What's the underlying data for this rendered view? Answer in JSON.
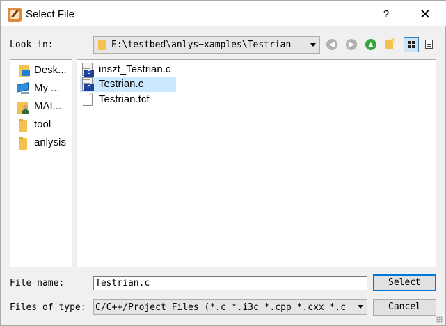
{
  "window": {
    "title": "Select File",
    "help_glyph": "?",
    "close_glyph": "✕"
  },
  "lookin": {
    "label": "Look in:",
    "path": "E:\\testbed\\anlys⋯xamples\\Testrian"
  },
  "toolbar": {
    "back_glyph": "◀",
    "forward_glyph": "▶",
    "up_glyph": "▲",
    "icons": [
      "back-icon",
      "forward-icon",
      "up-arrow-icon",
      "new-folder-icon",
      "detail-view-icon",
      "list-view-icon"
    ],
    "active_view": "detail"
  },
  "sidebar": {
    "items": [
      {
        "label": "Desk...",
        "icon": "desktop-icon"
      },
      {
        "label": "My ...",
        "icon": "computer-icon"
      },
      {
        "label": "MAI...",
        "icon": "user-folder-icon"
      },
      {
        "label": "tool",
        "icon": "folder-icon"
      },
      {
        "label": "anlysis",
        "icon": "folder-icon"
      }
    ]
  },
  "files": {
    "items": [
      {
        "name": "inszt_Testrian.c",
        "icon": "c-file-icon",
        "selected": false
      },
      {
        "name": "Testrian.c",
        "icon": "c-file-icon",
        "selected": true
      },
      {
        "name": "Testrian.tcf",
        "icon": "tcf-file-icon",
        "selected": false
      }
    ],
    "badge_text": "C"
  },
  "filename": {
    "label": "File name:",
    "value": "Testrian.c"
  },
  "filetype": {
    "label": "Files of type:",
    "value": "C/C++/Project Files (*.c *.i3c *.cpp *.cxx *.c"
  },
  "buttons": {
    "select": "Select",
    "cancel": "Cancel"
  },
  "colors": {
    "selection": "#cce8ff",
    "default_button_border": "#0078d7",
    "folder": "#f3c14f"
  }
}
